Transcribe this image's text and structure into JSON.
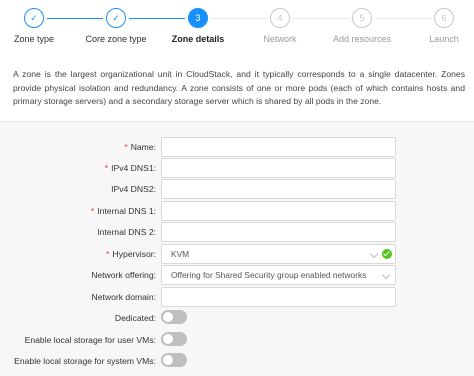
{
  "steps": [
    {
      "label": "Zone type",
      "status": "done",
      "icon": "check-icon",
      "number": ""
    },
    {
      "label": "Core zone type",
      "status": "done",
      "icon": "check-icon",
      "number": ""
    },
    {
      "label": "Zone details",
      "status": "active",
      "icon": "",
      "number": "3"
    },
    {
      "label": "Network",
      "status": "todo",
      "icon": "",
      "number": "4"
    },
    {
      "label": "Add resources",
      "status": "todo",
      "icon": "",
      "number": "5"
    },
    {
      "label": "Launch",
      "status": "todo",
      "icon": "",
      "number": "6"
    }
  ],
  "description": "A zone is the largest organizational unit in CloudStack, and it typically corresponds to a single datacenter. Zones provide physical isolation and redundancy. A zone consists of one or more pods (each of which contains hosts and primary storage servers) and a secondary storage server which is shared by all pods in the zone.",
  "form": {
    "name": {
      "label": "Name:",
      "required": true,
      "value": ""
    },
    "ipv4dns1": {
      "label": "IPv4 DNS1:",
      "required": true,
      "value": ""
    },
    "ipv4dns2": {
      "label": "IPv4 DNS2:",
      "required": false,
      "value": ""
    },
    "internaldns1": {
      "label": "Internal DNS 1:",
      "required": true,
      "value": ""
    },
    "internaldns2": {
      "label": "Internal DNS 2:",
      "required": false,
      "value": ""
    },
    "hypervisor": {
      "label": "Hypervisor:",
      "required": true,
      "value": "KVM"
    },
    "network_offering": {
      "label": "Network offering:",
      "required": false,
      "value": "Offering for Shared Security group enabled networks"
    },
    "network_domain": {
      "label": "Network domain:",
      "required": false,
      "value": ""
    },
    "dedicated": {
      "label": "Dedicated:",
      "on": false
    },
    "local_storage_user": {
      "label": "Enable local storage for user VMs:",
      "on": false
    },
    "local_storage_system": {
      "label": "Enable local storage for system VMs:",
      "on": false
    }
  },
  "colors": {
    "accent": "#1890ff",
    "required": "#f5222d",
    "success": "#52c41a"
  }
}
